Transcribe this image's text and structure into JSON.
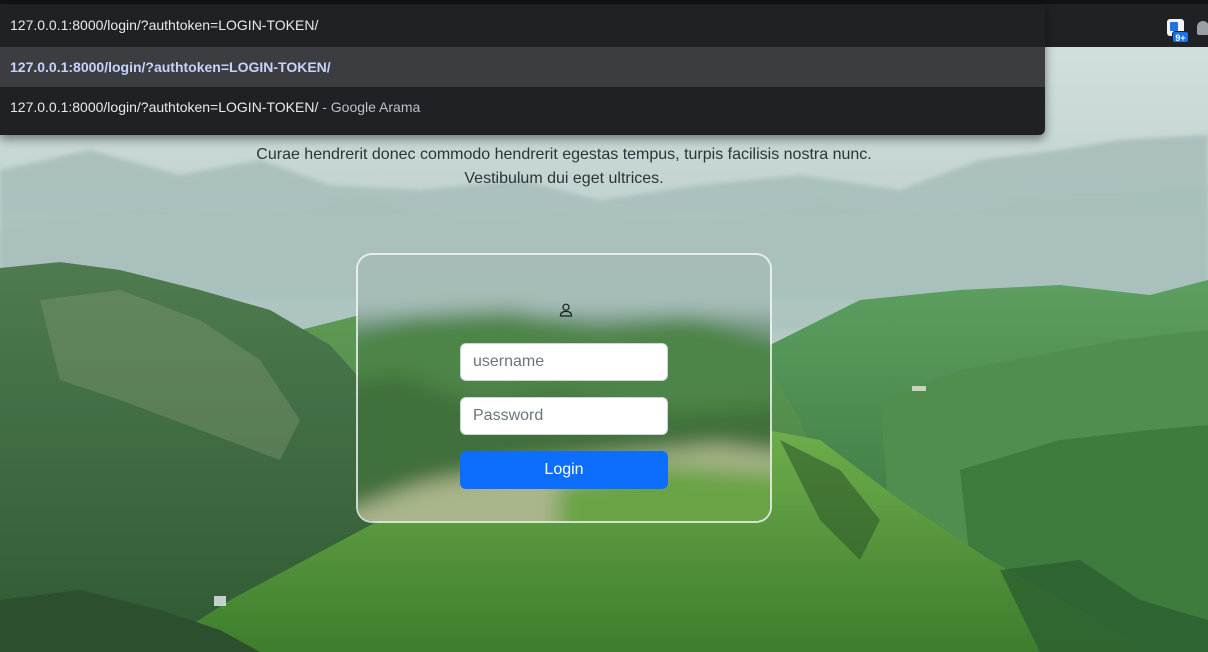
{
  "omnibox": {
    "input_text": "127.0.0.1:8000/login/?authtoken=LOGIN-TOKEN/",
    "suggestions": [
      {
        "text": "127.0.0.1:8000/login/?authtoken=LOGIN-TOKEN/",
        "suffix": ""
      },
      {
        "text": "127.0.0.1:8000/login/?authtoken=LOGIN-TOKEN/",
        "suffix": " - Google Arama"
      }
    ]
  },
  "toolbar": {
    "extension_badge": "9+"
  },
  "hero": {
    "tagline_line1": "Curae hendrerit donec commodo hendrerit egestas tempus, turpis facilisis nostra nunc.",
    "tagline_line2": "Vestibulum dui eget ultrices."
  },
  "login_form": {
    "user_icon": "user-icon",
    "username_placeholder": "username",
    "password_placeholder": "Password",
    "login_label": "Login"
  },
  "colors": {
    "accent": "#0d6efd",
    "omnibox_bg": "#202124",
    "omnibox_selected": "#3c3d41"
  }
}
